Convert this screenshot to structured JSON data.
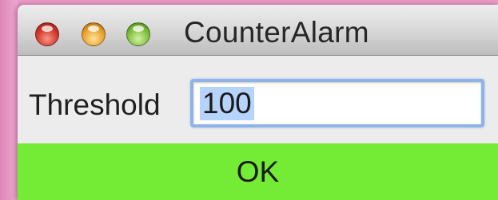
{
  "window": {
    "title": "CounterAlarm"
  },
  "form": {
    "threshold_label": "Threshold",
    "threshold_value": "100",
    "ok_label": "OK"
  },
  "colors": {
    "ok_button_background": "#74ec36",
    "selection_highlight": "#b6d3fb",
    "focus_ring": "#8fb3e8"
  },
  "icons": {
    "close": "close-traffic-light-icon",
    "minimize": "minimize-traffic-light-icon",
    "zoom": "zoom-traffic-light-icon"
  }
}
